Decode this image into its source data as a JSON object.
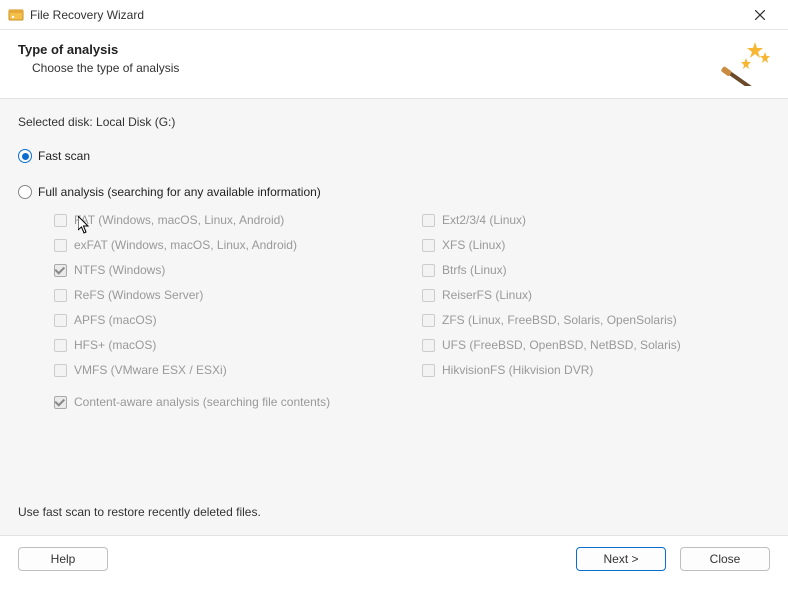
{
  "window": {
    "title": "File Recovery Wizard"
  },
  "header": {
    "title": "Type of analysis",
    "subtitle": "Choose the type of analysis"
  },
  "selected_disk_label": "Selected disk: Local Disk (G:)",
  "scan_options": {
    "fast_label": "Fast scan",
    "full_label": "Full analysis (searching for any available information)"
  },
  "filesystems": {
    "left": [
      {
        "label": "FAT (Windows, macOS, Linux, Android)",
        "checked": false
      },
      {
        "label": "exFAT (Windows, macOS, Linux, Android)",
        "checked": false
      },
      {
        "label": "NTFS (Windows)",
        "checked": true
      },
      {
        "label": "ReFS (Windows Server)",
        "checked": false
      },
      {
        "label": "APFS (macOS)",
        "checked": false
      },
      {
        "label": "HFS+ (macOS)",
        "checked": false
      },
      {
        "label": "VMFS (VMware ESX / ESXi)",
        "checked": false
      }
    ],
    "right": [
      {
        "label": "Ext2/3/4 (Linux)",
        "checked": false
      },
      {
        "label": "XFS (Linux)",
        "checked": false
      },
      {
        "label": "Btrfs (Linux)",
        "checked": false
      },
      {
        "label": "ReiserFS (Linux)",
        "checked": false
      },
      {
        "label": "ZFS (Linux, FreeBSD, Solaris, OpenSolaris)",
        "checked": false
      },
      {
        "label": "UFS (FreeBSD, OpenBSD, NetBSD, Solaris)",
        "checked": false
      },
      {
        "label": "HikvisionFS (Hikvision DVR)",
        "checked": false
      }
    ]
  },
  "content_aware": {
    "label": "Content-aware analysis (searching file contents)",
    "checked": true
  },
  "hint": "Use fast scan to restore recently deleted files.",
  "buttons": {
    "help": "Help",
    "next": "Next >",
    "close": "Close"
  }
}
